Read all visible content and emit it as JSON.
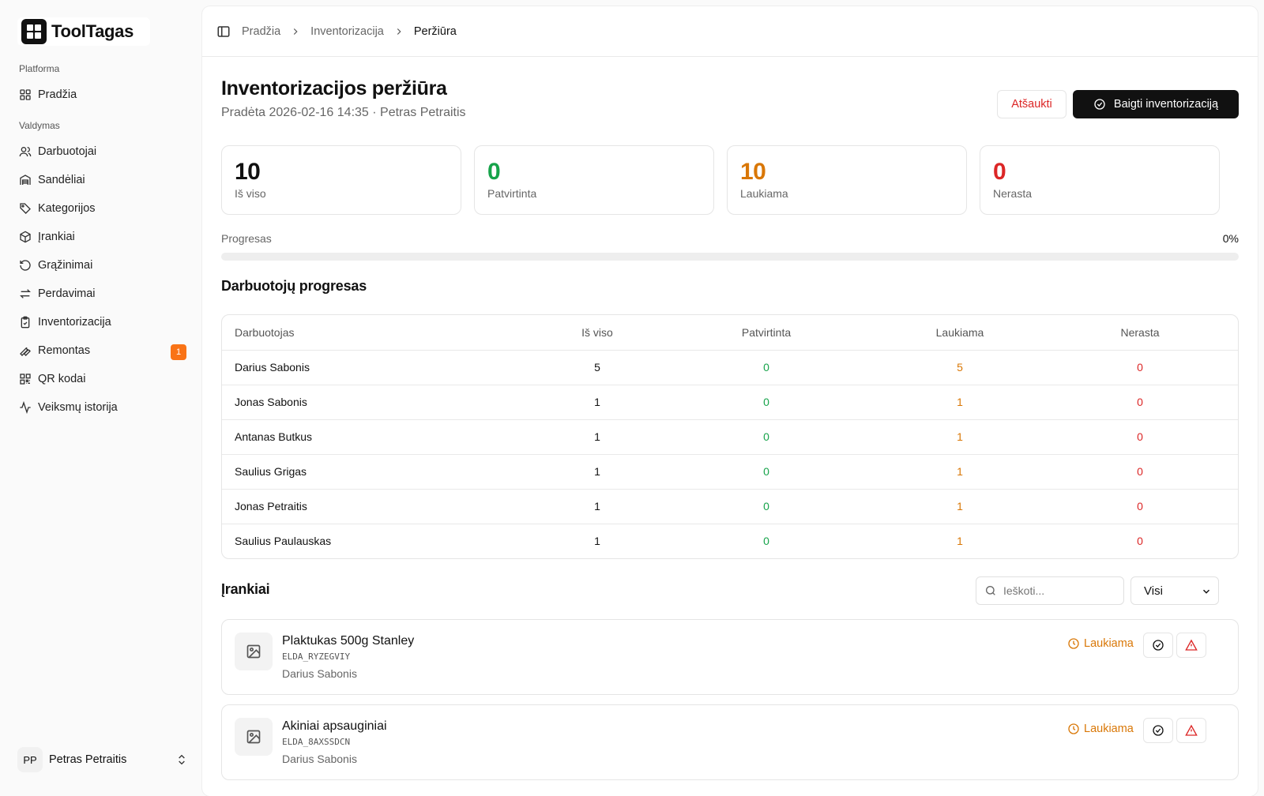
{
  "app": {
    "name": "ToolTagas"
  },
  "sidebar": {
    "group1": "Platforma",
    "group2": "Valdymas",
    "items": [
      {
        "label": "Pradžia",
        "icon": "grid-icon"
      },
      {
        "label": "Darbuotojai",
        "icon": "users-icon"
      },
      {
        "label": "Sandėliai",
        "icon": "warehouse-icon"
      },
      {
        "label": "Kategorijos",
        "icon": "tag-icon"
      },
      {
        "label": "Įrankiai",
        "icon": "package-icon"
      },
      {
        "label": "Grąžinimai",
        "icon": "rotate-ccw-icon"
      },
      {
        "label": "Perdavimai",
        "icon": "transfer-icon"
      },
      {
        "label": "Inventorizacija",
        "icon": "clipboard-check-icon"
      },
      {
        "label": "Remontas",
        "icon": "wrench-icon",
        "badge": "1"
      },
      {
        "label": "QR kodai",
        "icon": "qr-code-icon"
      },
      {
        "label": "Veiksmų istorija",
        "icon": "activity-icon"
      }
    ],
    "user": {
      "initials": "PP",
      "name": "Petras Petraitis"
    }
  },
  "breadcrumb": [
    "Pradžia",
    "Inventorizacija",
    "Peržiūra"
  ],
  "header": {
    "title": "Inventorizacijos peržiūra",
    "subtitle": "Pradėta 2026-02-16 14:35 · Petras Petraitis",
    "cancel_label": "Atšaukti",
    "finish_label": "Baigti inventorizaciją"
  },
  "stats": [
    {
      "value": "10",
      "label": "Iš viso",
      "color": "#111111"
    },
    {
      "value": "0",
      "label": "Patvirtinta",
      "color": "#16a34a"
    },
    {
      "value": "10",
      "label": "Laukiama",
      "color": "#d97706"
    },
    {
      "value": "0",
      "label": "Nerasta",
      "color": "#dc2626"
    }
  ],
  "progress": {
    "label": "Progresas",
    "value_text": "0%",
    "percent": 0
  },
  "employees": {
    "title": "Darbuotojų progresas",
    "columns": [
      "Darbuotojas",
      "Iš viso",
      "Patvirtinta",
      "Laukiama",
      "Nerasta"
    ],
    "rows": [
      {
        "name": "Darius Sabonis",
        "total": "5",
        "confirmed": "0",
        "pending": "5",
        "missing": "0"
      },
      {
        "name": "Jonas Sabonis",
        "total": "1",
        "confirmed": "0",
        "pending": "1",
        "missing": "0"
      },
      {
        "name": "Antanas Butkus",
        "total": "1",
        "confirmed": "0",
        "pending": "1",
        "missing": "0"
      },
      {
        "name": "Saulius Grigas",
        "total": "1",
        "confirmed": "0",
        "pending": "1",
        "missing": "0"
      },
      {
        "name": "Jonas Petraitis",
        "total": "1",
        "confirmed": "0",
        "pending": "1",
        "missing": "0"
      },
      {
        "name": "Saulius Paulauskas",
        "total": "1",
        "confirmed": "0",
        "pending": "1",
        "missing": "0"
      }
    ]
  },
  "tools": {
    "title": "Įrankiai",
    "search_placeholder": "Ieškoti...",
    "filter_value": "Visi",
    "items": [
      {
        "name": "Plaktukas 500g Stanley",
        "code": "ELDA_RYZEGVIY",
        "owner": "Darius Sabonis",
        "status": "Laukiama"
      },
      {
        "name": "Akiniai apsauginiai",
        "code": "ELDA_8AXSSDCN",
        "owner": "Darius Sabonis",
        "status": "Laukiama"
      }
    ]
  }
}
